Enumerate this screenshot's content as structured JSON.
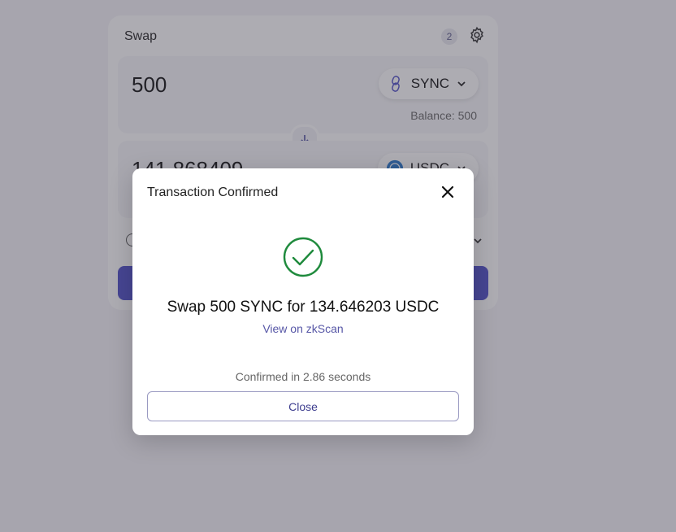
{
  "swap": {
    "title": "Swap",
    "settings_badge": "2",
    "from": {
      "amount": "500",
      "token": "SYNC",
      "balance_text": "Balance: 500"
    },
    "to": {
      "amount": "141.868409",
      "token": "USDC"
    }
  },
  "modal": {
    "title": "Transaction Confirmed",
    "summary": "Swap 500 SYNC for 134.646203 USDC",
    "link_text": "View on zkScan",
    "confirm_time": "Confirmed in 2.86 seconds",
    "close_label": "Close"
  },
  "colors": {
    "accent": "#4e4ec9",
    "success": "#1e8a3c",
    "link": "#5656a6"
  },
  "icons": {
    "settings": "gear-icon",
    "close": "close-icon",
    "success": "check-circle-icon",
    "swap_direction": "arrow-down-icon"
  }
}
